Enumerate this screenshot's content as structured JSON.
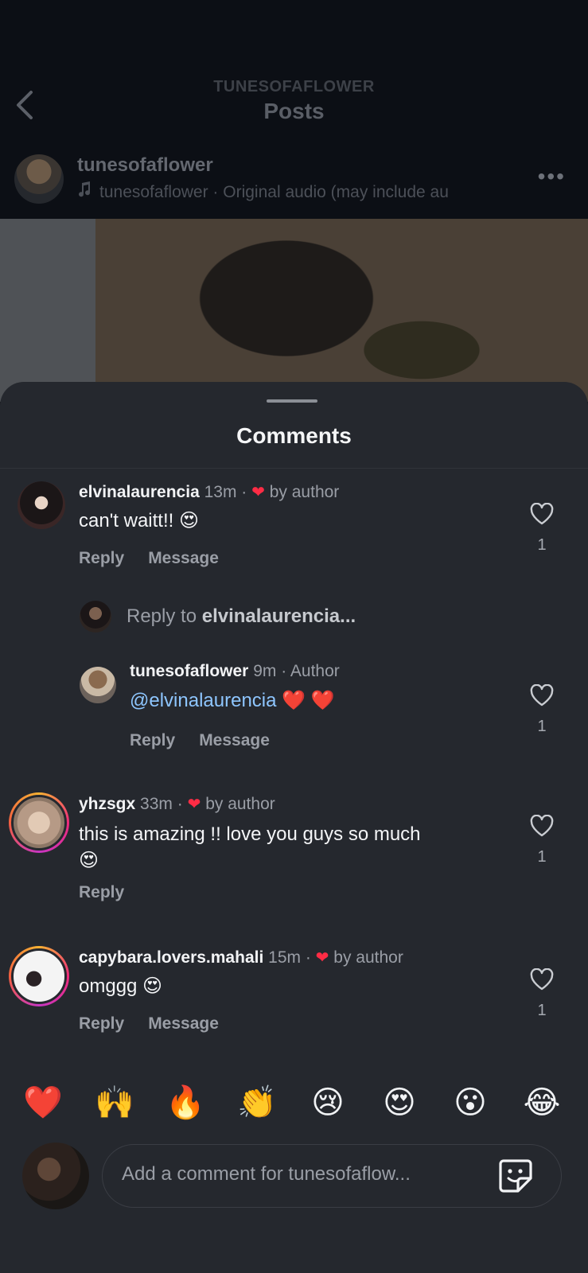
{
  "header": {
    "account_caps": "TUNESOFAFLOWER",
    "title": "Posts",
    "back_icon": "chevron-left-icon"
  },
  "post": {
    "username": "tunesofaflower",
    "audio": "tunesofaflower · Original audio  (may include au",
    "more_icon": "more-horizontal-icon"
  },
  "sheet": {
    "title": "Comments"
  },
  "comments": [
    {
      "username": "elvinalaurencia",
      "time": "13m",
      "badge": "by author",
      "text": "can't waitt!! 😍",
      "actions": [
        "Reply",
        "Message"
      ],
      "likes": "1"
    },
    {
      "username": "tunesofaflower",
      "time": "9m",
      "badge": "Author",
      "mention": "@elvinalaurencia",
      "text_suffix": " ❤️ ❤️",
      "actions": [
        "Reply",
        "Message"
      ],
      "likes": "1"
    },
    {
      "username": "yhzsgx",
      "time": "33m",
      "badge": "by author",
      "text_line1": "this is amazing !! love you guys so much",
      "text_line2": "😍",
      "actions": [
        "Reply"
      ],
      "likes": "1"
    },
    {
      "username": "capybara.lovers.mahali",
      "time": "15m",
      "badge": "by author",
      "text": "omggg 😍",
      "actions": [
        "Reply",
        "Message"
      ],
      "likes": "1"
    }
  ],
  "reply_prompt": {
    "prefix": "Reply to ",
    "target": "elvinalaurencia..."
  },
  "emoji_bar": [
    "❤️",
    "🙌",
    "🔥",
    "👏",
    "😢",
    "😍",
    "😮",
    "😂"
  ],
  "composer": {
    "placeholder": "Add a comment for tunesofaflow..."
  },
  "colors": {
    "sheet_bg": "#25282e",
    "heart_red": "#ff2c45",
    "mention_blue": "#8ec6ff"
  }
}
